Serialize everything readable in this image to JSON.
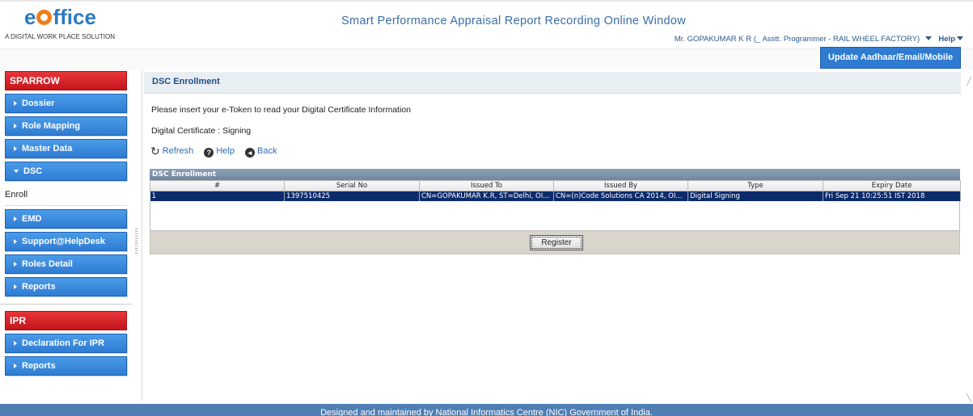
{
  "header": {
    "logo_text_a": "e",
    "logo_text_b": "ffice",
    "tagline": "A DIGITAL WORK PLACE SOLUTION",
    "app_title": "Smart Performance Appraisal Report Recording Online Window",
    "user": "Mr. GOPAKUMAR K R",
    "role": "(_ Asstt. Programmer - RAIL WHEEL FACTORY)",
    "help": "Help",
    "update_button": "Update Aadhaar/Email/Mobile"
  },
  "sidebar": {
    "sparrow_title": "SPARROW",
    "items": [
      {
        "label": "Dossier"
      },
      {
        "label": "Role Mapping"
      },
      {
        "label": "Master Data"
      },
      {
        "label": "DSC"
      },
      {
        "label": "Enroll"
      },
      {
        "label": "EMD"
      },
      {
        "label": "Support@HelpDesk"
      },
      {
        "label": "Roles Detail"
      },
      {
        "label": "Reports"
      }
    ],
    "ipr_title": "IPR",
    "ipr_items": [
      {
        "label": "Declaration For IPR"
      },
      {
        "label": "Reports"
      }
    ]
  },
  "main": {
    "panel_title": "DSC Enrollment",
    "info_line": "Please insert your e-Token to read your Digital Certificate Information",
    "cert_line": "Digital Certificate : Signing",
    "actions": {
      "refresh": "Refresh",
      "help": "Help",
      "back": "Back"
    },
    "grid": {
      "caption": "DSC Enrollment",
      "columns": [
        "#",
        "Serial No",
        "Issued To",
        "Issued By",
        "Type",
        "Expiry Date"
      ],
      "rows": [
        [
          "1",
          "1397510425",
          "CN=GOPAKUMAR K.R, ST=Delhi, OI...",
          "CN=(n)Code Solutions CA 2014, OI...",
          "Digital Signing",
          "Fri Sep 21 10:25:51 IST 2018"
        ]
      ],
      "register_button": "Register"
    }
  },
  "footer": {
    "text": "Designed and maintained by National Informatics Centre (NIC) Government of India."
  },
  "colors": {
    "accent_blue": "#2f7cd3",
    "section_red": "#c4161c",
    "selected_row": "#0c2b6b",
    "footer": "#4f7fb4"
  }
}
